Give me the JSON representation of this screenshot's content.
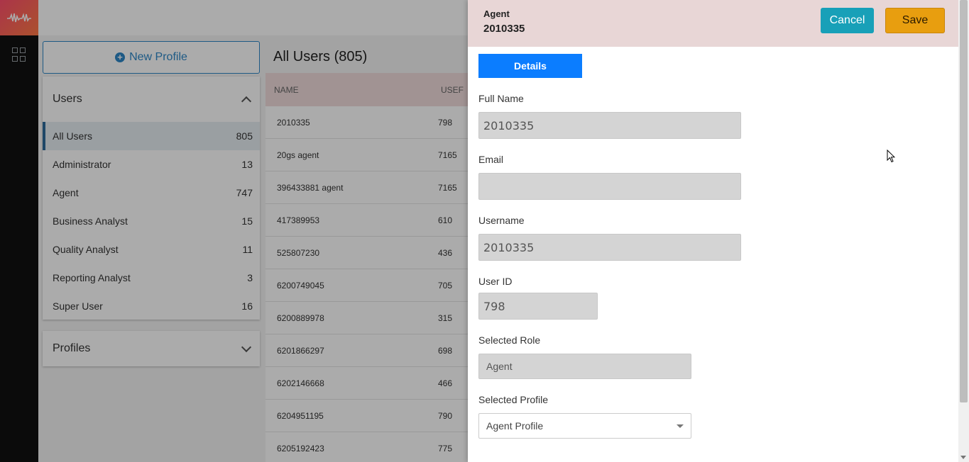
{
  "sidebar": {
    "logo_icon": "waveform-logo-icon",
    "apps_icon": "apps-grid-icon"
  },
  "left": {
    "new_profile_label": "New Profile",
    "users_title": "Users",
    "roles": [
      {
        "label": "All Users",
        "count": "805"
      },
      {
        "label": "Administrator",
        "count": "13"
      },
      {
        "label": "Agent",
        "count": "747"
      },
      {
        "label": "Business Analyst",
        "count": "15"
      },
      {
        "label": "Quality Analyst",
        "count": "11"
      },
      {
        "label": "Reporting Analyst",
        "count": "3"
      },
      {
        "label": "Super User",
        "count": "16"
      }
    ],
    "profiles_title": "Profiles"
  },
  "list": {
    "title": "All Users (805)",
    "col_name": "NAME",
    "col_user": "USEF",
    "rows": [
      {
        "name": "2010335",
        "id": "798"
      },
      {
        "name": "20gs agent",
        "id": "7165"
      },
      {
        "name": "396433881 agent",
        "id": "7165"
      },
      {
        "name": "417389953",
        "id": "610"
      },
      {
        "name": "525807230",
        "id": "436"
      },
      {
        "name": "6200749045",
        "id": "705"
      },
      {
        "name": "6200889978",
        "id": "315"
      },
      {
        "name": "6201866297",
        "id": "698"
      },
      {
        "name": "6202146668",
        "id": "466"
      },
      {
        "name": "6204951195",
        "id": "790"
      },
      {
        "name": "6205192423",
        "id": "775"
      }
    ]
  },
  "drawer": {
    "role": "Agent",
    "name": "2010335",
    "cancel_label": "Cancel",
    "save_label": "Save",
    "tab_details": "Details",
    "full_name_label": "Full Name",
    "full_name_value": "2010335",
    "email_label": "Email",
    "email_value": "",
    "username_label": "Username",
    "username_value": "2010335",
    "userid_label": "User ID",
    "userid_value": "798",
    "role_label": "Selected Role",
    "role_value": "Agent",
    "profile_label": "Selected Profile",
    "profile_value": "Agent Profile"
  },
  "colors": {
    "accent": "#0b7dff",
    "cancel": "#18a0b8",
    "save": "#e89e0f",
    "header": "#e8d6d6"
  }
}
